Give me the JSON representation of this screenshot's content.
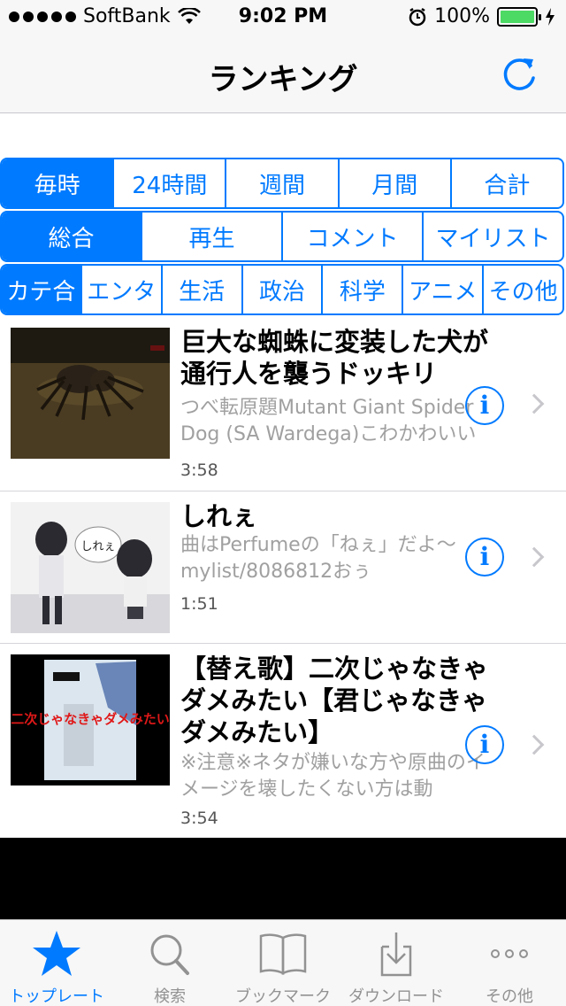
{
  "status_bar": {
    "carrier": "SoftBank",
    "time": "9:02 PM",
    "battery": "100%"
  },
  "nav": {
    "title": "ランキング",
    "refresh_icon": "refresh-icon"
  },
  "period_tabs": [
    "毎時",
    "24時間",
    "週間",
    "月間",
    "合計"
  ],
  "type_tabs": [
    "総合",
    "再生",
    "コメント",
    "マイリスト"
  ],
  "category_tabs": [
    "カテ合",
    "エンタ",
    "生活",
    "政治",
    "科学",
    "アニメ",
    "その他"
  ],
  "videos": [
    {
      "title": "巨大な蜘蛛に変装した犬が通行人を襲うドッキリ",
      "description": "つべ転原題Mutant Giant Spider Dog (SA Wardega)こわかわいい",
      "duration": "3:58"
    },
    {
      "title": "しれぇ",
      "description": "曲はPerfumeの「ねぇ」だよ～ mylist/8086812おぅ",
      "duration": "1:51",
      "thumb_text": "しれぇ"
    },
    {
      "title": "【替え歌】二次じゃなきゃダメみたい【君じゃなきゃダメみたい】",
      "description": "※注意※ネタが嫌いな方や原曲のイメージを壊したくない方は動",
      "duration": "3:54",
      "thumb_text": "二次じゃなきゃダメみたい"
    }
  ],
  "tab_bar": {
    "items": [
      {
        "label": "トップレート",
        "icon": "star-icon",
        "active": true
      },
      {
        "label": "検索",
        "icon": "search-icon",
        "active": false
      },
      {
        "label": "ブックマーク",
        "icon": "book-icon",
        "active": false
      },
      {
        "label": "ダウンロード",
        "icon": "download-icon",
        "active": false
      },
      {
        "label": "その他",
        "icon": "more-icon",
        "active": false
      }
    ]
  },
  "colors": {
    "accent": "#007aff",
    "bar_bg": "#f7f7f7",
    "secondary_text": "#a0a0a0",
    "battery_fill": "#4cd964"
  }
}
